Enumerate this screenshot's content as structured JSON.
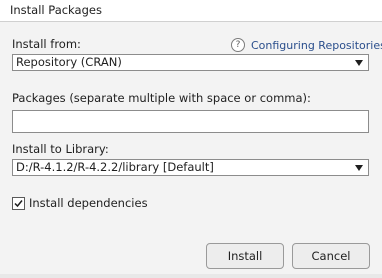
{
  "window": {
    "title": "Install Packages"
  },
  "install_from": {
    "label": "Install from:",
    "help_link": "Configuring Repositories",
    "selected": "Repository (CRAN)"
  },
  "packages": {
    "label": "Packages (separate multiple with space or comma):",
    "value": ""
  },
  "library": {
    "label": "Install to Library:",
    "selected": "D:/R-4.1.2/R-4.2.2/library [Default]"
  },
  "dependencies": {
    "label": "Install dependencies",
    "checked": true
  },
  "buttons": {
    "install": "Install",
    "cancel": "Cancel"
  },
  "icons": {
    "help": "?"
  }
}
